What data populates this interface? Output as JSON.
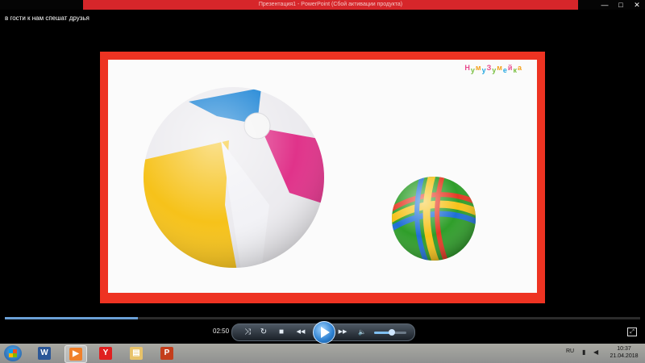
{
  "window": {
    "title": "Презентация1 - PowerPoint (Сбой активации продукта)",
    "minimize_glyph": "—",
    "maximize_glyph": "□",
    "close_glyph": "✕"
  },
  "video": {
    "title": "в гости к нам спешат друзья",
    "time": "02:50",
    "progress": 0.21,
    "volume": 0.55
  },
  "slide": {
    "brand_letters": [
      "Н",
      "у",
      "м",
      "у",
      "З",
      "у",
      "м",
      "е",
      "й",
      "к",
      "а"
    ],
    "brand_colors": [
      "#e84a8c",
      "#7bc043",
      "#f4a21c",
      "#29a9e1",
      "#e84a8c",
      "#7bc043",
      "#f4a21c",
      "#29a9e1",
      "#e84a8c",
      "#7bc043",
      "#f4a21c"
    ],
    "border_color": "#ee3322"
  },
  "controls": {
    "shuffle_icon": "shuffle-icon",
    "repeat_icon": "repeat-icon",
    "stop_icon": "stop-icon",
    "prev_icon": "rewind-icon",
    "play_icon": "play-icon",
    "next_icon": "fast-forward-icon",
    "volume_icon": "volume-icon",
    "shuffle_glyph": "⤨",
    "repeat_glyph": "↻",
    "stop_glyph": "■",
    "prev_glyph": "◀◀",
    "next_glyph": "▶▶",
    "volume_glyph": "🔈",
    "fullscreen_glyph": "⤢"
  },
  "taskbar": {
    "apps": [
      {
        "name": "word",
        "glyph": "W",
        "color": "#2b5797",
        "active": false
      },
      {
        "name": "media-player",
        "glyph": "▶",
        "color": "#f0802a",
        "active": true
      },
      {
        "name": "yandex-browser",
        "glyph": "Y",
        "color": "#e02020",
        "active": false
      },
      {
        "name": "file-explorer",
        "glyph": "▤",
        "color": "#e8c36a",
        "active": false
      },
      {
        "name": "powerpoint",
        "glyph": "P",
        "color": "#c43e1c",
        "active": false
      }
    ],
    "language": "RU",
    "clock_time": "10:37",
    "clock_date": "21.04.2018"
  }
}
